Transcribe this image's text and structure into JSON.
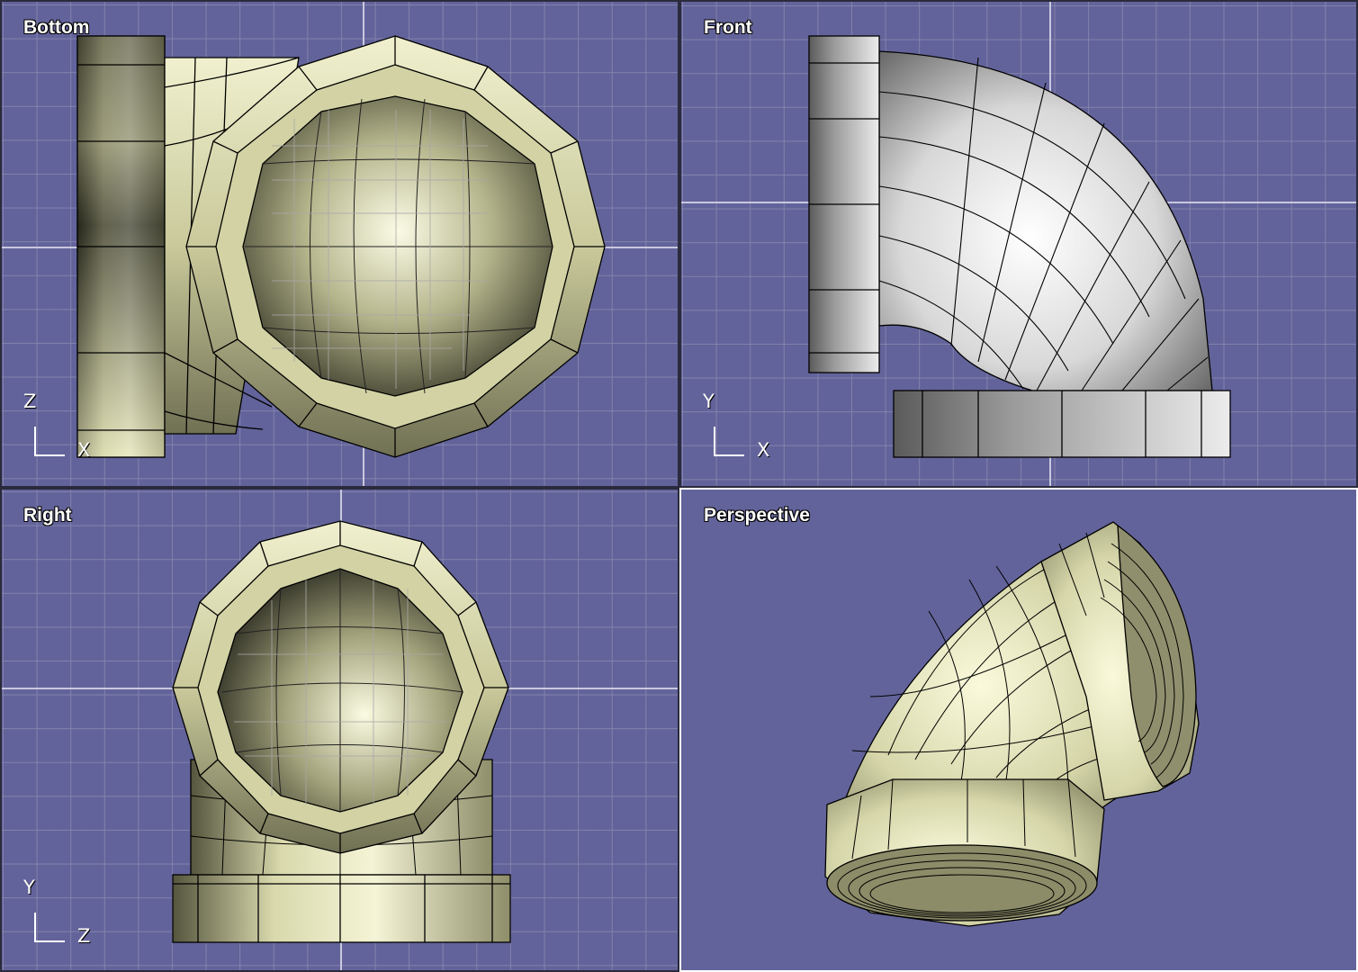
{
  "viewports": {
    "bottom": {
      "label": "Bottom",
      "axis_up": "Z",
      "axis_right": "X"
    },
    "front": {
      "label": "Front",
      "axis_up": "Y",
      "axis_right": "X"
    },
    "right": {
      "label": "Right",
      "axis_up": "Y",
      "axis_right": "Z"
    },
    "perspective": {
      "label": "Perspective"
    }
  },
  "colors": {
    "viewport_bg": "#63639b",
    "grid": "#8787af",
    "model_tan": "#dcdcb0",
    "model_gray": "#d8d8d8",
    "edge": "#000000"
  }
}
